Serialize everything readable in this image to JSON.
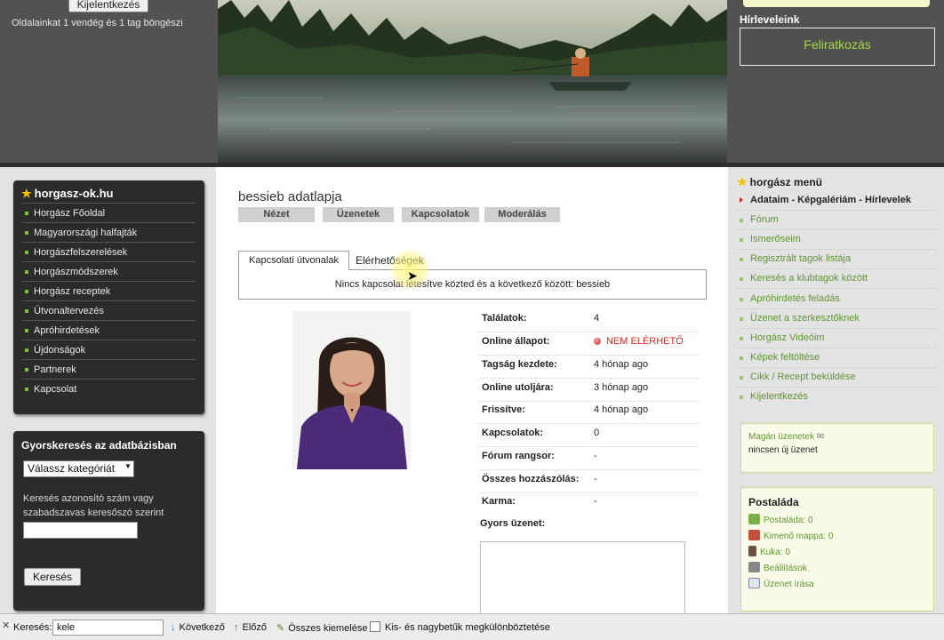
{
  "header": {
    "logout_button": "Kijelentkezés",
    "visitors_text": "Oldalainkat 1 vendég és 1 tag böngészi",
    "newsletter_title": "Hírleveleink",
    "newsletter_subscribe": "Feliratkozás"
  },
  "left_menu": {
    "title": "horgasz-ok.hu",
    "items": [
      "Horgász Főoldal",
      "Magyarországi halfajták",
      "Horgászfelszerelések",
      "Horgászmódszerek",
      "Horgász receptek",
      "Útvonaltervezés",
      "Apróhirdetések",
      "Újdonságok",
      "Partnerek",
      "Kapcsolat"
    ]
  },
  "quick_search": {
    "title": "Gyorskeresés az adatbázisban",
    "category_selected": "Válassz kategóriát",
    "help": "Keresés azonosító szám vagy szabadszavas keresőszó szerint",
    "button": "Keresés"
  },
  "profile": {
    "title": "bessieb adatlapja",
    "tabs": [
      "Nézet",
      "Üzenetek",
      "Kapcsolatok",
      "Moderálás"
    ],
    "inner_tabs": [
      "Kapcsolati útvonalak",
      "Elérhetőségek"
    ],
    "contact_message": "Nincs kapcsolat létesítve közted és a következő között: bessieb",
    "stats": [
      {
        "label": "Találatok:",
        "value": "4"
      },
      {
        "label": "Online állapot:",
        "value": "NEM ELÉRHETŐ"
      },
      {
        "label": "Tagság kezdete:",
        "value": "4 hónap ago"
      },
      {
        "label": "Online utoljára:",
        "value": "3 hónap ago"
      },
      {
        "label": "Frissítve:",
        "value": "4 hónap ago"
      },
      {
        "label": "Kapcsolatok:",
        "value": "0"
      },
      {
        "label": "Fórum rangsor:",
        "value": "-"
      },
      {
        "label": "Összes hozzászólás:",
        "value": "-"
      },
      {
        "label": "Karma:",
        "value": "-"
      }
    ],
    "quick_message_label": "Gyors üzenet:"
  },
  "right_menu": {
    "title": "horgász menü",
    "items": [
      "Adataim - Képgalériám - Hírlevelek",
      "Fórum",
      "Ismerőseim",
      "Regisztrált tagok listája",
      "Keresés a klubtagok között",
      "Apróhirdetés feladás",
      "Üzenet a szerkesztőknek",
      "Horgász Videóim",
      "Képek feltöltése",
      "Cikk / Recept beküldése",
      "Kijelentkezés"
    ]
  },
  "private_messages": {
    "link": "Magán üzenetek",
    "status": "nincsen új üzenet"
  },
  "mailbox": {
    "title": "Postaláda",
    "items": [
      "Postaláda: 0",
      "Kimenő mappa: 0",
      "Kuka: 0",
      "Beállítások",
      "Üzenet írása"
    ]
  },
  "find_bar": {
    "label": "Keresés:",
    "value": "kele",
    "next": "Következő",
    "prev": "Előző",
    "highlight_all": "Összes kiemelése",
    "match_case": "Kis- és nagybetűk megkülönböztetése"
  },
  "colors": {
    "accent_green": "#5f9431",
    "dark_panel": "#2b2b2b",
    "offline_red": "#d0281e"
  }
}
